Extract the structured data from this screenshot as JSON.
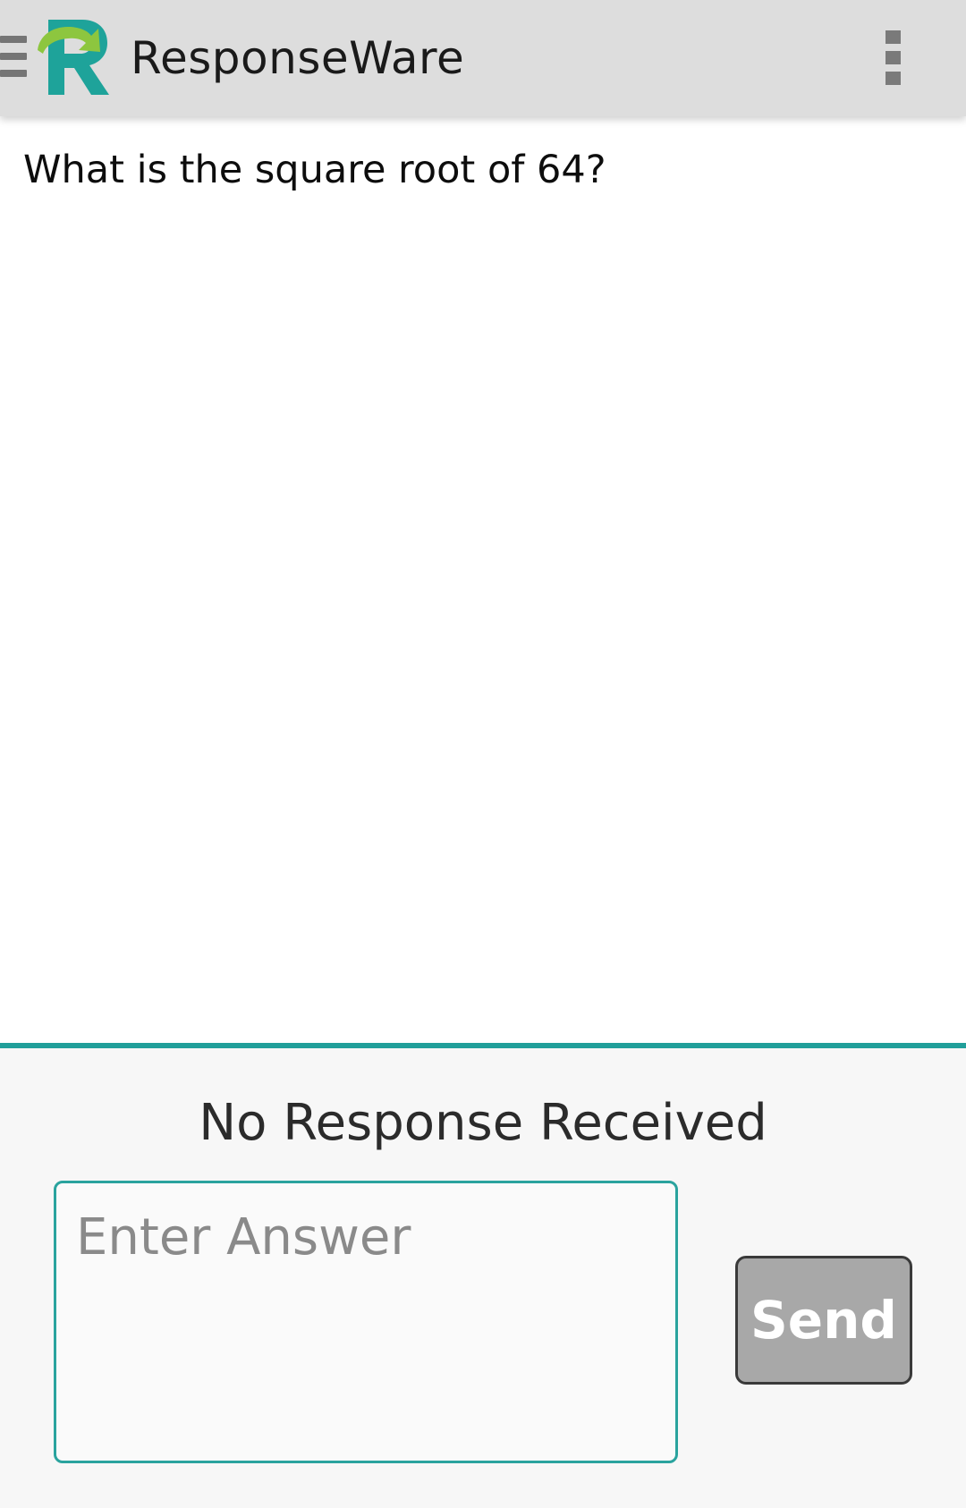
{
  "app": {
    "title": "ResponseWare",
    "brand_colors": {
      "teal": "#1ea39a",
      "green": "#8dc63f",
      "action_bar": "#dddddd",
      "accent_line": "#219f9a"
    }
  },
  "icons": {
    "drawer": "hamburger-menu-icon",
    "logo": "responseware-logo",
    "overflow": "three-dot-overflow-icon"
  },
  "question": {
    "text": "What is the square root of 64?"
  },
  "response": {
    "status": "No Response Received",
    "answer_value": "",
    "answer_placeholder": "Enter Answer",
    "send_label": "Send"
  }
}
